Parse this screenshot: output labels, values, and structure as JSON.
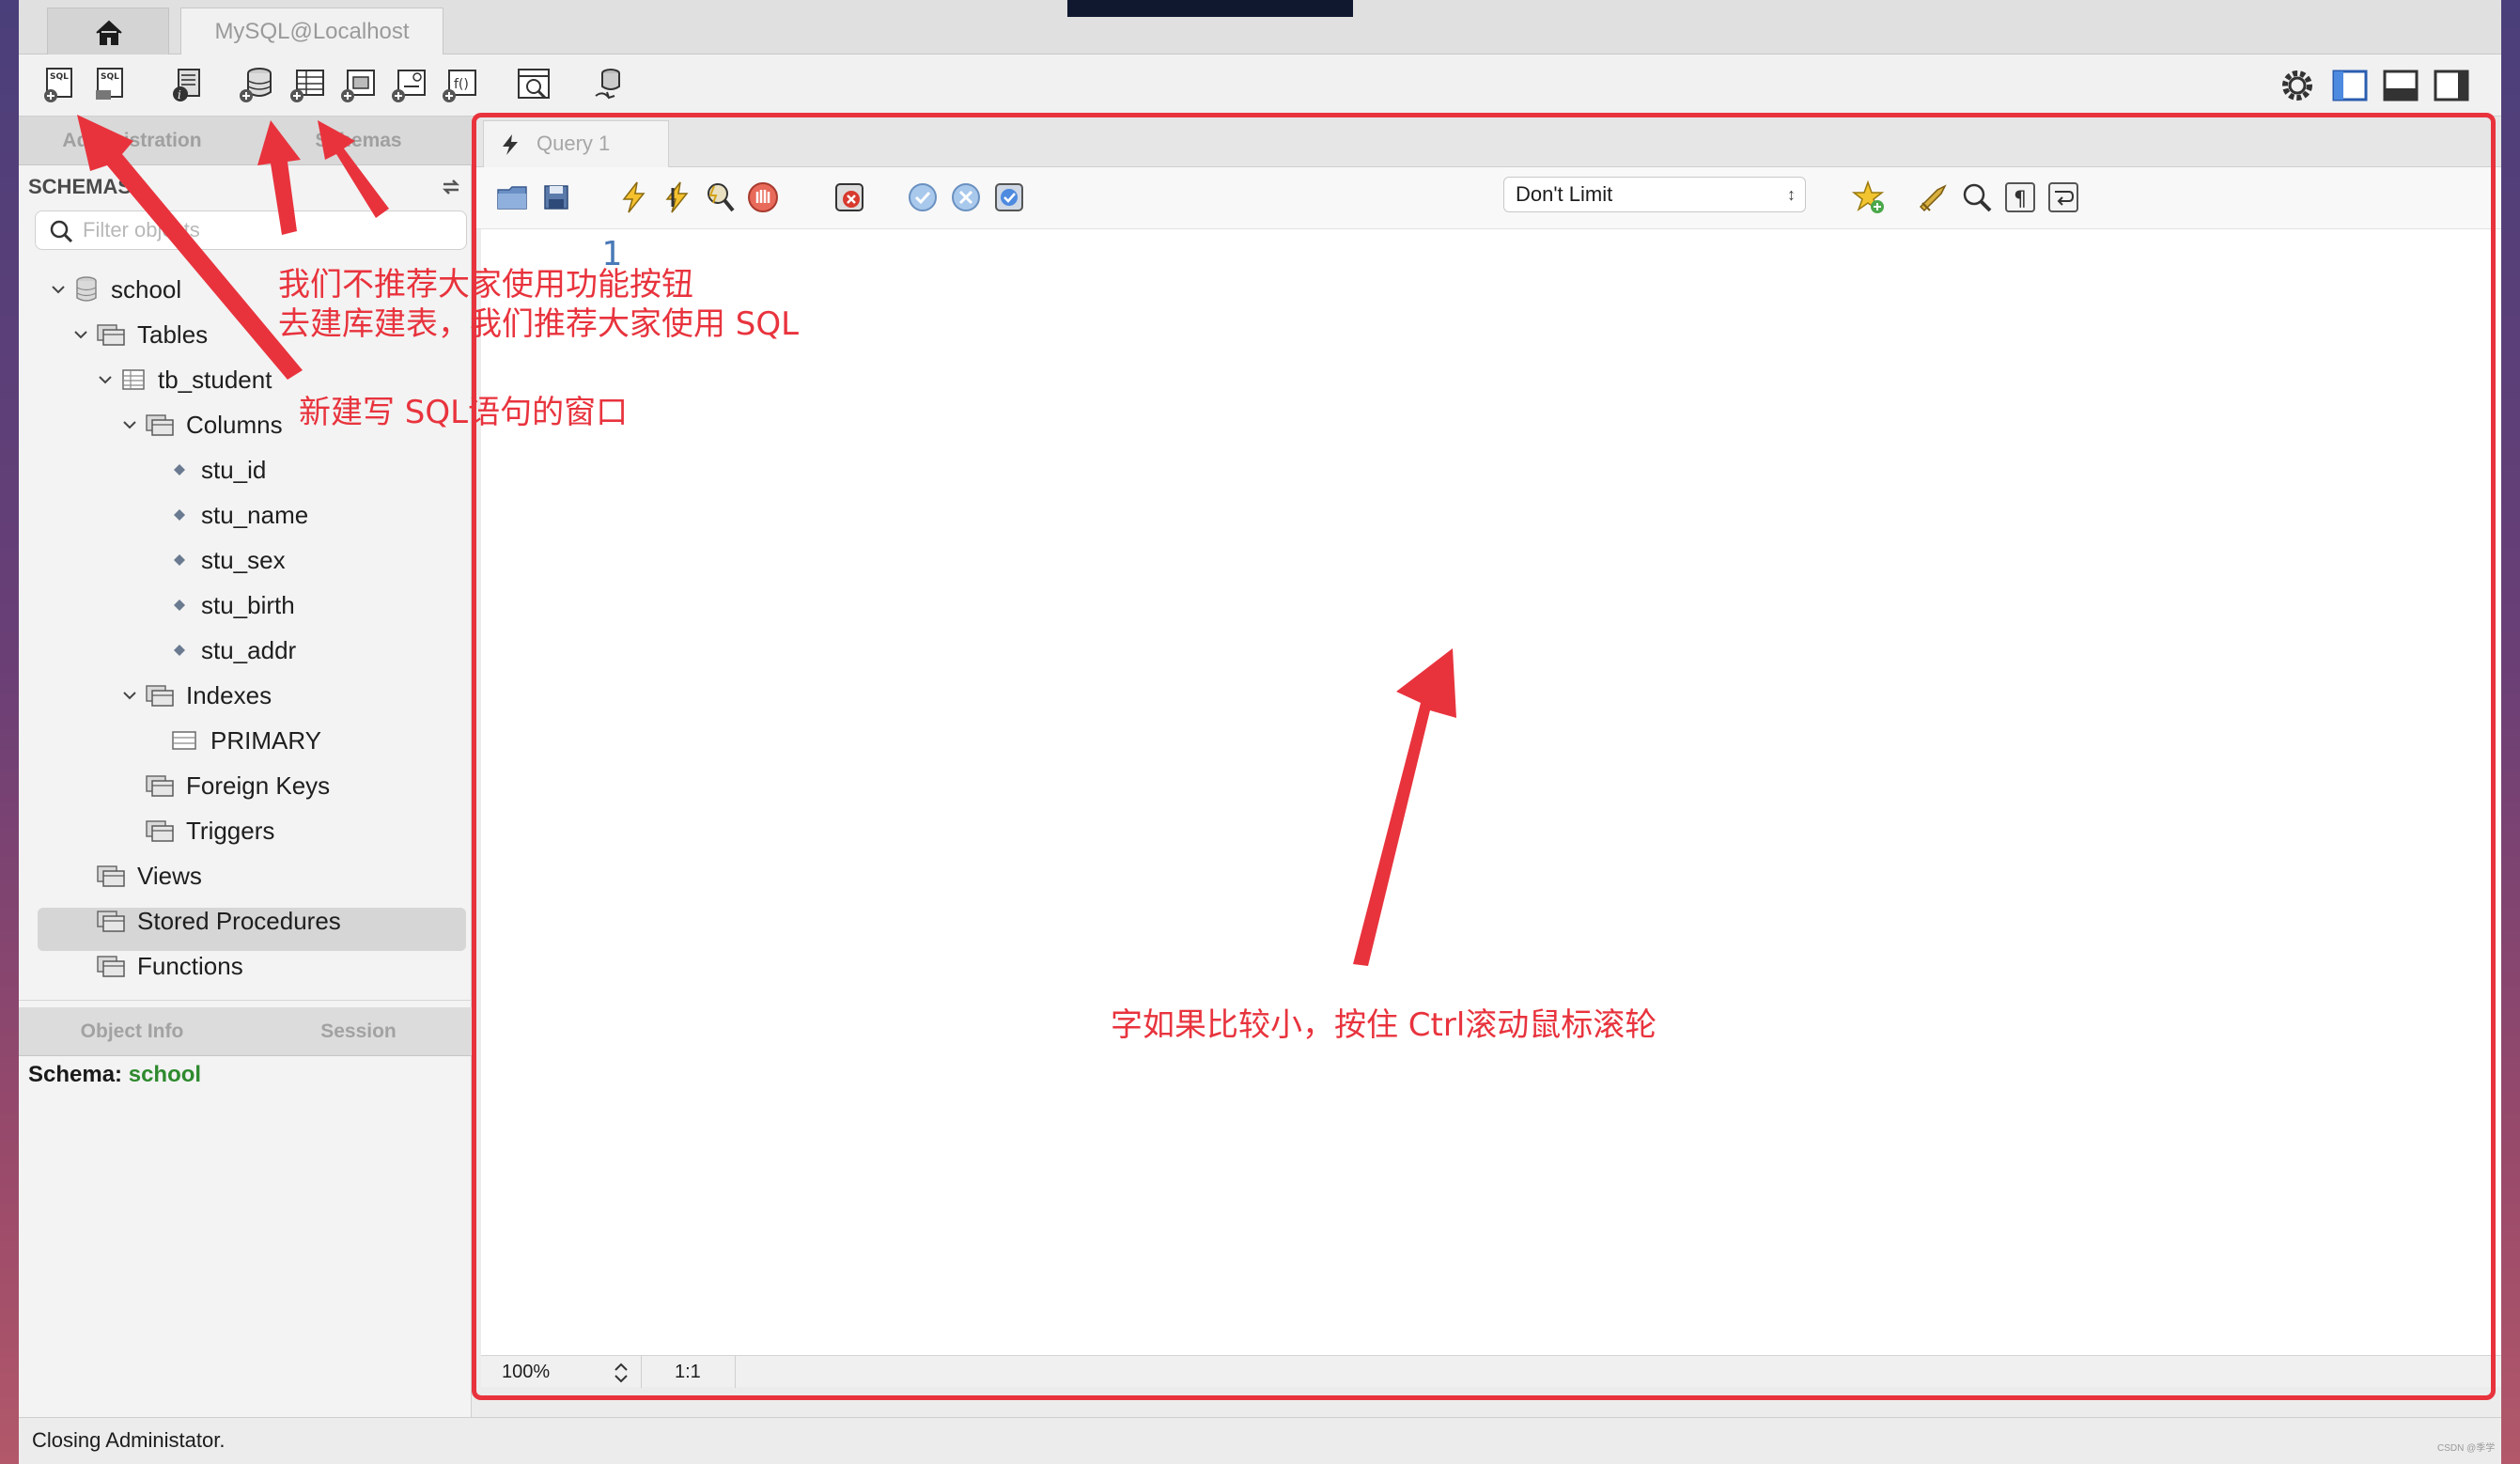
{
  "tabs": {
    "home_icon": "home-icon",
    "connection": "MySQL@Localhost"
  },
  "sidebar": {
    "tabs": [
      "Administration",
      "Schemas"
    ],
    "header": "SCHEMAS",
    "filter_placeholder": "Filter objects",
    "tree": [
      {
        "label": "school",
        "icon": "database-icon",
        "expanded": true
      },
      {
        "label": "Tables",
        "icon": "folder-icon",
        "expanded": true
      },
      {
        "label": "tb_student",
        "icon": "table-icon",
        "expanded": true
      },
      {
        "label": "Columns",
        "icon": "folder-icon",
        "expanded": true
      },
      {
        "label": "stu_id",
        "icon": "column-icon"
      },
      {
        "label": "stu_name",
        "icon": "column-icon"
      },
      {
        "label": "stu_sex",
        "icon": "column-icon"
      },
      {
        "label": "stu_birth",
        "icon": "column-icon"
      },
      {
        "label": "stu_addr",
        "icon": "column-icon"
      },
      {
        "label": "Indexes",
        "icon": "folder-icon",
        "expanded": true
      },
      {
        "label": "PRIMARY",
        "icon": "index-icon"
      },
      {
        "label": "Foreign Keys",
        "icon": "folder-icon"
      },
      {
        "label": "Triggers",
        "icon": "folder-icon"
      },
      {
        "label": "Views",
        "icon": "folder-icon"
      },
      {
        "label": "Stored Procedures",
        "icon": "folder-icon",
        "selected": true
      },
      {
        "label": "Functions",
        "icon": "folder-icon"
      }
    ],
    "info_tabs": [
      "Object Info",
      "Session"
    ],
    "schema_info_label": "Schema:",
    "schema_info_value": "school"
  },
  "query": {
    "tab_label": "Query 1",
    "limit_value": "Don't Limit",
    "line_number": "1",
    "zoom": "100%",
    "position": "1:1"
  },
  "status_bar": "Closing Administator.",
  "watermark": "CSDN @季学",
  "annotations": {
    "button_note_line1": "我们不推荐大家使用功能按钮",
    "button_note_line2": "去建库建表，我们推荐大家使用 SQL",
    "new_query_note": "新建写 SQL语句的窗口",
    "font_note": "字如果比较小，按住 Ctrl滚动鼠标滚轮",
    "color": "#e8333d"
  }
}
